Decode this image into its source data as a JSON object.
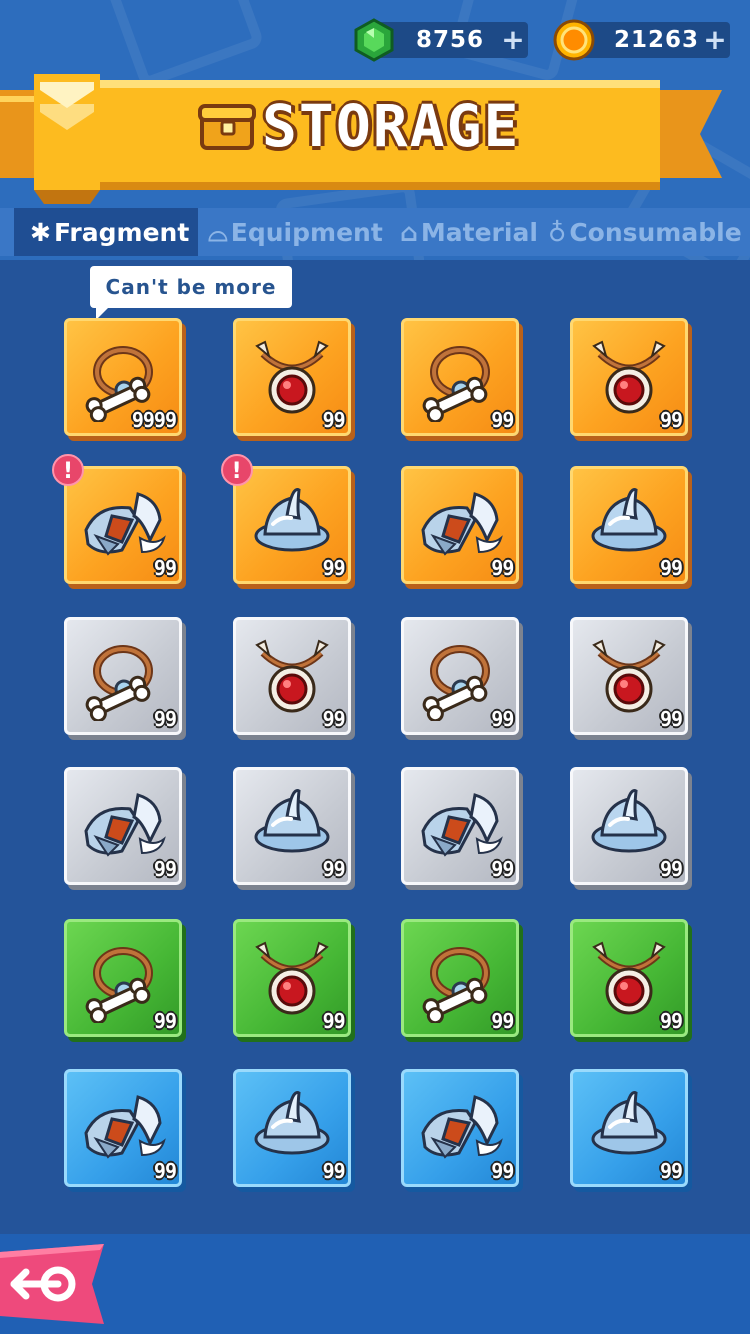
{
  "currency": {
    "gems": "8756",
    "gems_plus": "+",
    "coins": "21263",
    "coins_plus": "+"
  },
  "header": {
    "title": "STORAGE"
  },
  "tabs": [
    {
      "label": "Fragment",
      "icon": "puzzle-icon",
      "active": true
    },
    {
      "label": "Equipment",
      "icon": "shoe-icon",
      "active": false
    },
    {
      "label": "Material",
      "icon": "scroll-icon",
      "active": false
    },
    {
      "label": "Consumable",
      "icon": "potion-icon",
      "active": false
    }
  ],
  "tooltip": {
    "text": "Can't be more"
  },
  "items": [
    {
      "icon": "bone-necklace-icon",
      "rarity": "orange",
      "count": "9999",
      "alert": false
    },
    {
      "icon": "ruby-amulet-icon",
      "rarity": "orange",
      "count": "99",
      "alert": false
    },
    {
      "icon": "bone-necklace-icon",
      "rarity": "orange",
      "count": "99",
      "alert": false
    },
    {
      "icon": "ruby-amulet-icon",
      "rarity": "orange",
      "count": "99",
      "alert": false
    },
    {
      "icon": "armored-boot-icon",
      "rarity": "orange",
      "count": "99",
      "alert": true
    },
    {
      "icon": "steel-helmet-icon",
      "rarity": "orange",
      "count": "99",
      "alert": true
    },
    {
      "icon": "armored-boot-icon",
      "rarity": "orange",
      "count": "99",
      "alert": false
    },
    {
      "icon": "steel-helmet-icon",
      "rarity": "orange",
      "count": "99",
      "alert": false
    },
    {
      "icon": "bone-necklace-icon",
      "rarity": "gray",
      "count": "99",
      "alert": false
    },
    {
      "icon": "ruby-amulet-icon",
      "rarity": "gray",
      "count": "99",
      "alert": false
    },
    {
      "icon": "bone-necklace-icon",
      "rarity": "gray",
      "count": "99",
      "alert": false
    },
    {
      "icon": "ruby-amulet-icon",
      "rarity": "gray",
      "count": "99",
      "alert": false
    },
    {
      "icon": "armored-boot-icon",
      "rarity": "gray",
      "count": "99",
      "alert": false
    },
    {
      "icon": "steel-helmet-icon",
      "rarity": "gray",
      "count": "99",
      "alert": false
    },
    {
      "icon": "armored-boot-icon",
      "rarity": "gray",
      "count": "99",
      "alert": false
    },
    {
      "icon": "steel-helmet-icon",
      "rarity": "gray",
      "count": "99",
      "alert": false
    },
    {
      "icon": "bone-necklace-icon",
      "rarity": "green",
      "count": "99",
      "alert": false
    },
    {
      "icon": "ruby-amulet-icon",
      "rarity": "green",
      "count": "99",
      "alert": false
    },
    {
      "icon": "bone-necklace-icon",
      "rarity": "green",
      "count": "99",
      "alert": false
    },
    {
      "icon": "ruby-amulet-icon",
      "rarity": "green",
      "count": "99",
      "alert": false
    },
    {
      "icon": "armored-boot-icon",
      "rarity": "blue",
      "count": "99",
      "alert": false
    },
    {
      "icon": "steel-helmet-icon",
      "rarity": "blue",
      "count": "99",
      "alert": false
    },
    {
      "icon": "armored-boot-icon",
      "rarity": "blue",
      "count": "99",
      "alert": false
    },
    {
      "icon": "steel-helmet-icon",
      "rarity": "blue",
      "count": "99",
      "alert": false
    }
  ],
  "alert_mark": "!",
  "colors": {
    "background": "#24549a",
    "banner": "#fdbb1f",
    "accent_pink": "#e8466a"
  }
}
